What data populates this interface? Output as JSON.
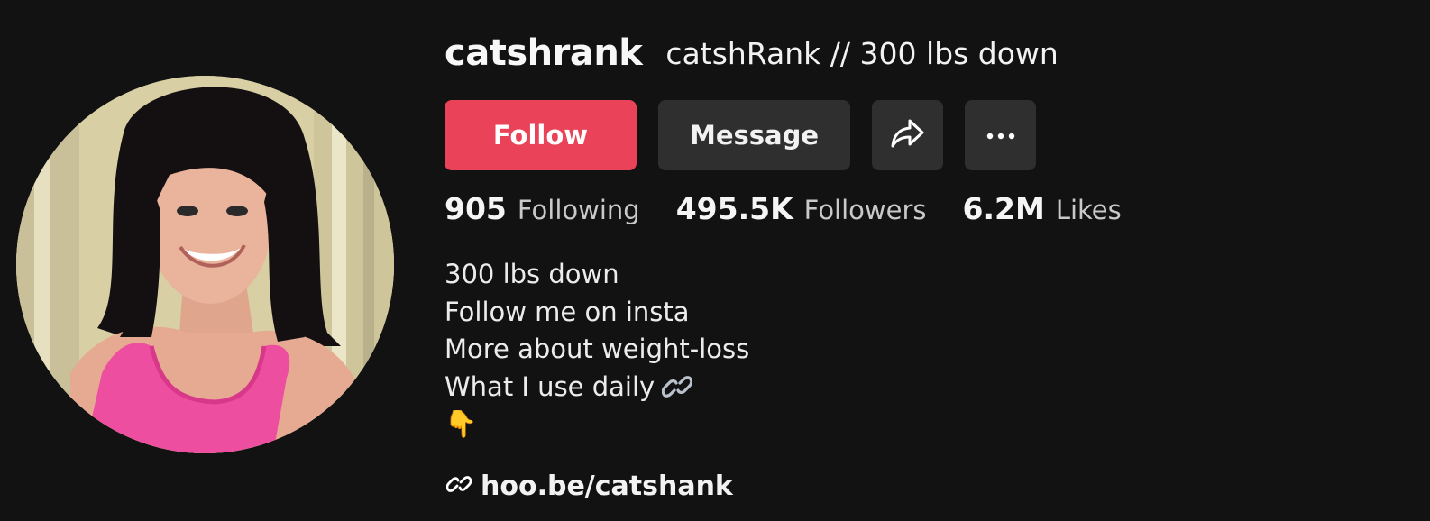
{
  "profile": {
    "username": "catshrank",
    "nickname": "catshRank // 300 lbs down"
  },
  "actions": {
    "follow_label": "Follow",
    "message_label": "Message",
    "share_icon": "share-icon",
    "more_icon": "more-icon"
  },
  "stats": [
    {
      "value": "905",
      "label": "Following"
    },
    {
      "value": "495.5K",
      "label": "Followers"
    },
    {
      "value": "6.2M",
      "label": "Likes"
    }
  ],
  "bio": {
    "line1": "300 lbs down",
    "line2": "Follow me on insta",
    "line3": "More about weight-loss",
    "line4": "What I use daily",
    "line5": "👇"
  },
  "link": {
    "text": "hoo.be/catshank",
    "icon": "link-icon"
  },
  "colors": {
    "background": "#121212",
    "follow_button": "#ea4359",
    "secondary_button": "#2f2f2f"
  }
}
